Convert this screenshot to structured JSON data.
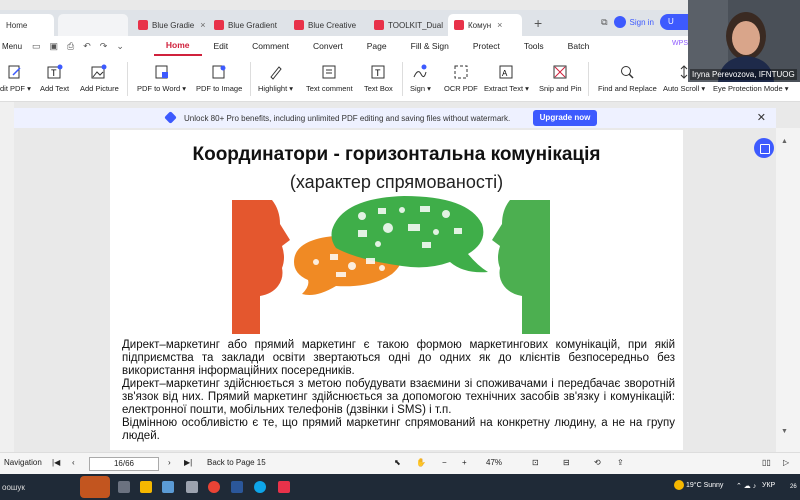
{
  "tabs": {
    "home": "Home",
    "items": [
      {
        "label": "Blue Gradie"
      },
      {
        "label": "Blue Gradient"
      },
      {
        "label": "Blue Creative"
      },
      {
        "label": "TOOLKIT_Dual"
      },
      {
        "label": "Комун"
      }
    ],
    "sign_in": "Sign in",
    "upgrade": "U"
  },
  "menubar": {
    "menu": "Menu",
    "tabs": [
      "Home",
      "Edit",
      "Comment",
      "Convert",
      "Page",
      "Fill & Sign",
      "Protect",
      "Tools",
      "Batch"
    ],
    "wps": "WPS"
  },
  "ribbon": {
    "items": [
      {
        "label": "dit PDF ▾",
        "icon": "edit-pdf-icon"
      },
      {
        "label": "Add Text",
        "icon": "add-text-icon"
      },
      {
        "label": "Add Picture",
        "icon": "add-picture-icon"
      },
      {
        "label": "PDF to Word ▾",
        "icon": "pdf-to-word-icon"
      },
      {
        "label": "PDF to Image",
        "icon": "pdf-to-image-icon"
      },
      {
        "label": "Highlight ▾",
        "icon": "highlight-icon"
      },
      {
        "label": "Text comment",
        "icon": "text-comment-icon"
      },
      {
        "label": "Text Box",
        "icon": "text-box-icon"
      },
      {
        "label": "Sign ▾",
        "icon": "sign-icon"
      },
      {
        "label": "OCR PDF",
        "icon": "ocr-icon"
      },
      {
        "label": "Extract Text ▾",
        "icon": "extract-text-icon"
      },
      {
        "label": "Snip and Pin",
        "icon": "snip-icon"
      },
      {
        "label": "Find and Replace",
        "icon": "search-icon"
      },
      {
        "label": "Auto Scroll ▾",
        "icon": "auto-scroll-icon"
      },
      {
        "label": "Eye Protection Mode ▾",
        "icon": "eye-icon"
      }
    ]
  },
  "promo": {
    "text": "Unlock 80+ Pro benefits, including unlimited PDF editing and saving files without watermark.",
    "button": "Upgrade now"
  },
  "slide": {
    "title": "Координатори - горизонтальна комунікація",
    "subtitle": "(характер спрямованості)",
    "p1": "Директ–маркетинг або прямий маркетинг є такою формою маркетингових комунікацій, при якій підприємства та заклади освіти звертаються одні до одних як до клієнтів безпосередньо без використання інформаційних посередників.",
    "p2": "Директ–маркетинг здійснюється з метою побудувати взаємини зі споживачами і передбачає зворотній зв'язок від них. Прямий маркетинг здійснюється за допомогою технічних засобів зв'язку і комунікацій: електронної пошти, мобільних телефонів (дзвінки і SMS) і т.п.",
    "p3": "Відмінною особливістю є те, що прямий маркетинг спрямований на конкретну людину, а не на групу людей."
  },
  "statusbar": {
    "navigation": "Navigation",
    "page": "16/66",
    "back": "Back to Page 15",
    "zoom": "47%"
  },
  "taskbar": {
    "search": "оошук",
    "weather": "19°C  Sunny",
    "lang": "УКР",
    "date": "26"
  },
  "webcam": {
    "name": "Iryna Perevozova, IFNTUOG"
  }
}
